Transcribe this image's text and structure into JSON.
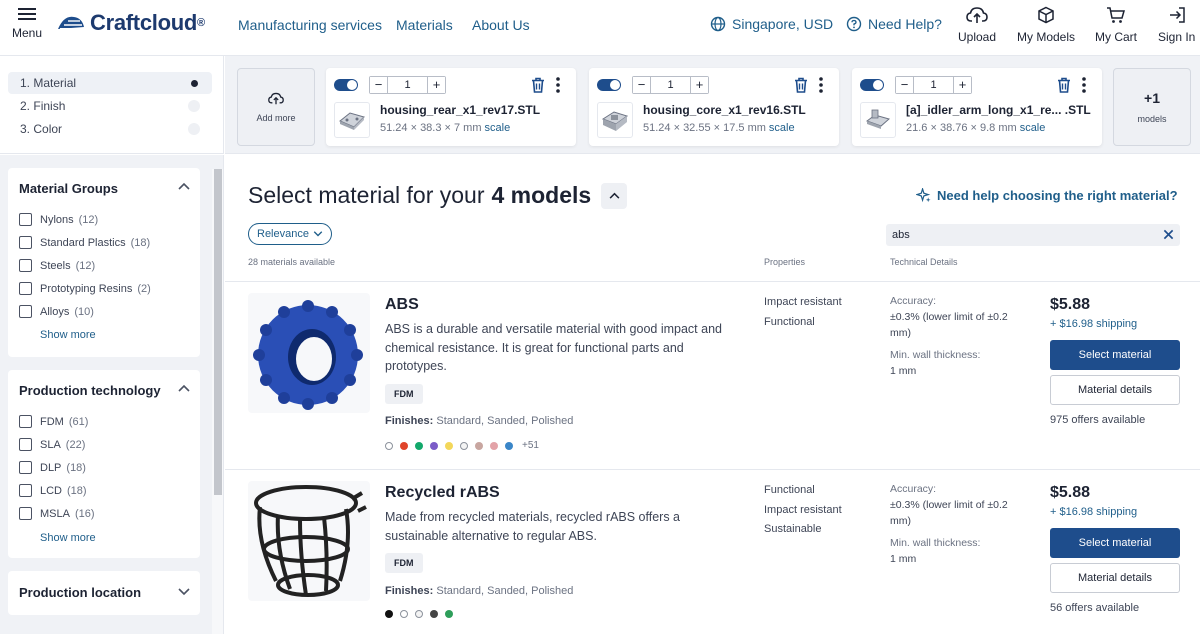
{
  "header": {
    "menu_label": "Menu",
    "logo_text": "Craftcloud",
    "logo_reg": "®",
    "nav": [
      "Manufacturing services",
      "Materials",
      "About Us"
    ],
    "region": "Singapore, USD",
    "help": "Need Help?",
    "actions": [
      "Upload",
      "My Models",
      "My Cart",
      "Sign In"
    ]
  },
  "steps": [
    {
      "num": "1.",
      "label": "Material"
    },
    {
      "num": "2.",
      "label": "Finish"
    },
    {
      "num": "3.",
      "label": "Color"
    }
  ],
  "filters": {
    "material_groups": {
      "title": "Material Groups",
      "items": [
        {
          "label": "Nylons",
          "count": "(12)"
        },
        {
          "label": "Standard Plastics",
          "count": "(18)"
        },
        {
          "label": "Steels",
          "count": "(12)"
        },
        {
          "label": "Prototyping Resins",
          "count": "(2)"
        },
        {
          "label": "Alloys",
          "count": "(10)"
        }
      ],
      "show_more": "Show more"
    },
    "production_technology": {
      "title": "Production technology",
      "items": [
        {
          "label": "FDM",
          "count": "(61)"
        },
        {
          "label": "SLA",
          "count": "(22)"
        },
        {
          "label": "DLP",
          "count": "(18)"
        },
        {
          "label": "LCD",
          "count": "(18)"
        },
        {
          "label": "MSLA",
          "count": "(16)"
        }
      ],
      "show_more": "Show more"
    },
    "production_location": {
      "title": "Production location"
    }
  },
  "models_bar": {
    "add_more": "Add more",
    "models": [
      {
        "qty": "1",
        "name": "housing_rear_x1_rev17.STL",
        "dims": "51.24 × 38.3 × 7 mm",
        "scale": "scale"
      },
      {
        "qty": "1",
        "name": "housing_core_x1_rev16.STL",
        "dims": "51.24 × 32.55 × 17.5 mm",
        "scale": "scale"
      },
      {
        "qty": "1",
        "name": "[a]_idler_arm_long_x1_re... .STL",
        "dims": "21.6 × 38.76 × 9.8 mm",
        "scale": "scale"
      }
    ],
    "more_count": "+1",
    "more_label": "models"
  },
  "main": {
    "heading_prefix": "Select material for your",
    "heading_bold": "4 models",
    "help_choose": "Need help choosing the right material?",
    "sort_label": "Relevance",
    "search_value": "abs",
    "materials_count": "28 materials available",
    "col_properties": "Properties",
    "col_technical": "Technical Details"
  },
  "materials": [
    {
      "title": "ABS",
      "description": "ABS is a durable and versatile material with good impact and chemical resistance. It is great for functional parts and prototypes.",
      "tag": "FDM",
      "finishes_label": "Finishes:",
      "finishes": "Standard, Sanded, Polished",
      "swatches": [
        "#ffffff",
        "#e0442a",
        "#12a86b",
        "#7b5cc8",
        "#f3d75a",
        "#f4f4f4",
        "#c8a6a0",
        "#e3a3a8",
        "#3a86c8"
      ],
      "swatches_more": "+51",
      "properties": [
        "Impact resistant",
        "Functional"
      ],
      "accuracy_label": "Accuracy:",
      "accuracy": "±0.3% (lower limit of ±0.2 mm)",
      "wall_label": "Min. wall thickness:",
      "wall": "1 mm",
      "price": "$5.88",
      "shipping": "+ $16.98 shipping",
      "select": "Select material",
      "details": "Material details",
      "offers": "975 offers available"
    },
    {
      "title": "Recycled rABS",
      "description": "Made from recycled materials, recycled rABS offers a sustainable alternative to regular ABS.",
      "tag": "FDM",
      "finishes_label": "Finishes:",
      "finishes": "Standard, Sanded, Polished",
      "swatches": [
        "#111111",
        "#ffffff",
        "#f4f4f4",
        "#444444",
        "#2e9e5a"
      ],
      "properties": [
        "Functional",
        "Impact resistant",
        "Sustainable"
      ],
      "accuracy_label": "Accuracy:",
      "accuracy": "±0.3% (lower limit of ±0.2 mm)",
      "wall_label": "Min. wall thickness:",
      "wall": "1 mm",
      "price": "$5.88",
      "shipping": "+ $16.98 shipping",
      "select": "Select material",
      "details": "Material details",
      "offers": "56 offers available"
    }
  ]
}
